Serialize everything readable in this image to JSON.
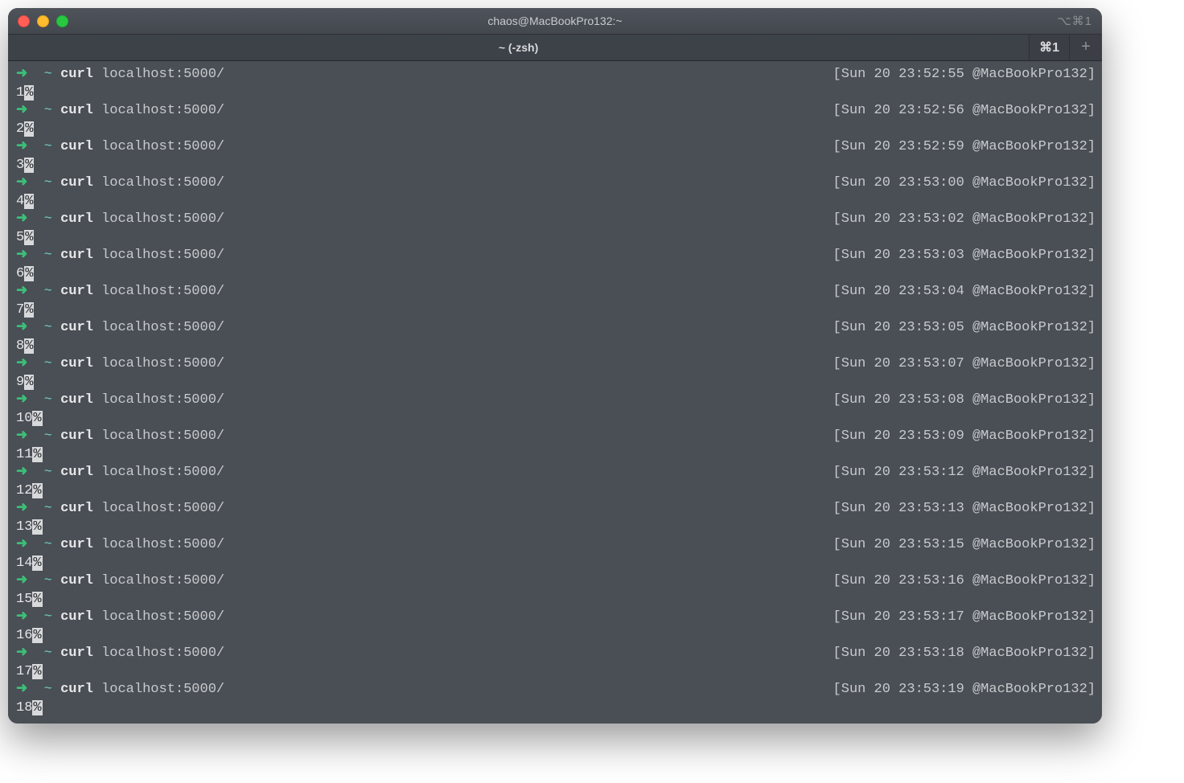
{
  "window": {
    "title": "chaos@MacBookPro132:~",
    "titlebar_right_glyph": "⌥⌘1"
  },
  "tab": {
    "label": "~ (-zsh)",
    "shortcut": "⌘1"
  },
  "prompt": {
    "arrow": "➜",
    "tilde": "~",
    "cmd_bold": "curl",
    "cmd_rest": " localhost:5000/",
    "host": "@MacBookPro132"
  },
  "entries": [
    {
      "time": "Sun 20 23:52:55",
      "output": "1"
    },
    {
      "time": "Sun 20 23:52:56",
      "output": "2"
    },
    {
      "time": "Sun 20 23:52:59",
      "output": "3"
    },
    {
      "time": "Sun 20 23:53:00",
      "output": "4"
    },
    {
      "time": "Sun 20 23:53:02",
      "output": "5"
    },
    {
      "time": "Sun 20 23:53:03",
      "output": "6"
    },
    {
      "time": "Sun 20 23:53:04",
      "output": "7"
    },
    {
      "time": "Sun 20 23:53:05",
      "output": "8"
    },
    {
      "time": "Sun 20 23:53:07",
      "output": "9"
    },
    {
      "time": "Sun 20 23:53:08",
      "output": "10"
    },
    {
      "time": "Sun 20 23:53:09",
      "output": "11"
    },
    {
      "time": "Sun 20 23:53:12",
      "output": "12"
    },
    {
      "time": "Sun 20 23:53:13",
      "output": "13"
    },
    {
      "time": "Sun 20 23:53:15",
      "output": "14"
    },
    {
      "time": "Sun 20 23:53:16",
      "output": "15"
    },
    {
      "time": "Sun 20 23:53:17",
      "output": "16"
    },
    {
      "time": "Sun 20 23:53:18",
      "output": "17"
    },
    {
      "time": "Sun 20 23:53:19",
      "output": "18"
    }
  ],
  "percent_glyph": "%",
  "plus_glyph": "+"
}
